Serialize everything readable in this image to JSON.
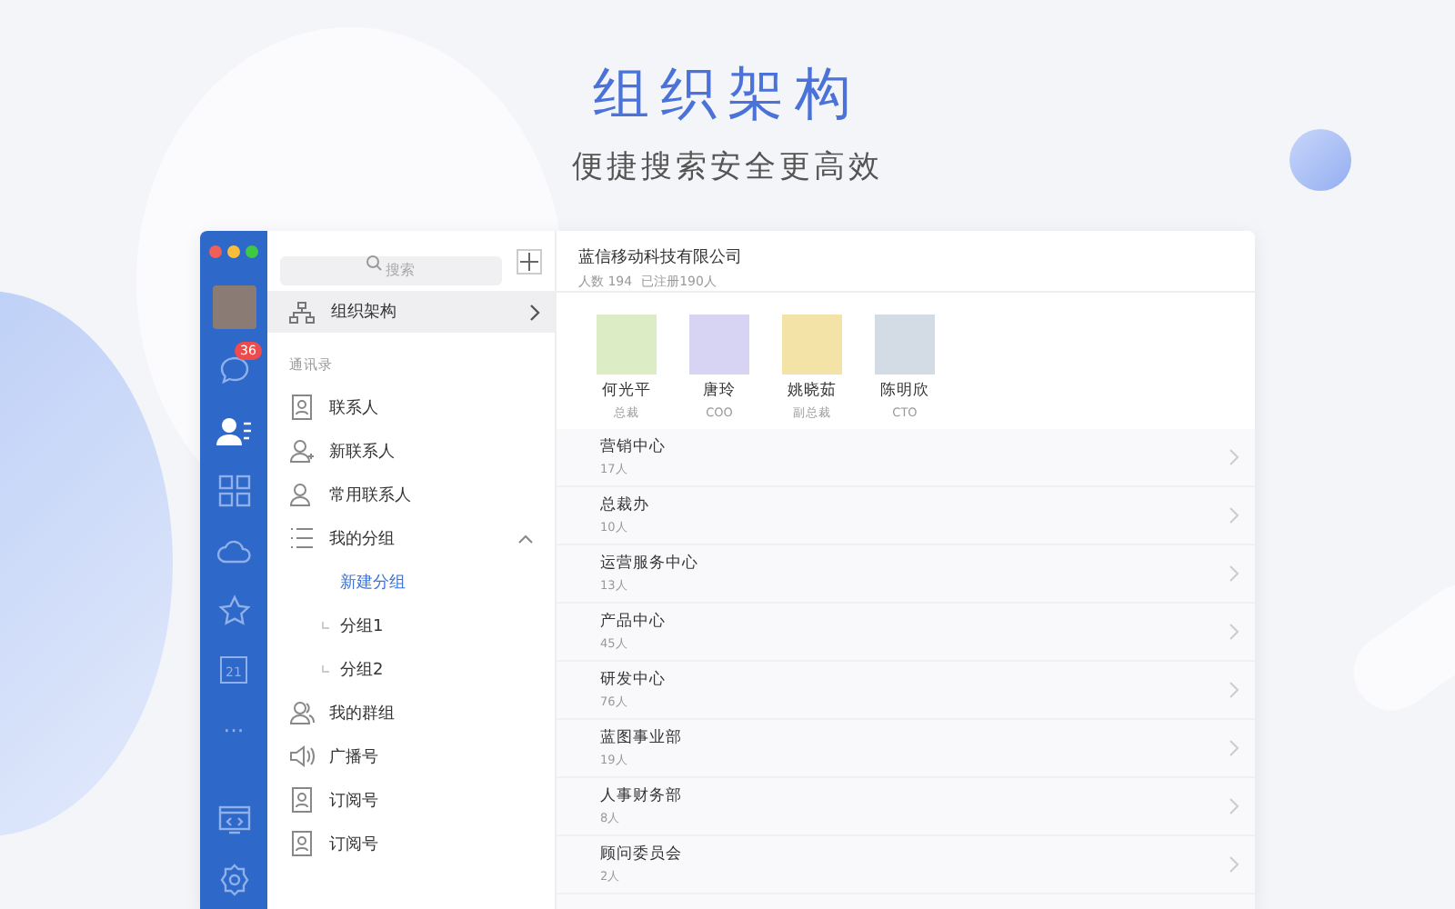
{
  "hero": {
    "title": "组织架构",
    "subtitle": "便捷搜索安全更高效"
  },
  "rail": {
    "items": [
      {
        "kind": "chat",
        "selected": false,
        "badge": "36"
      },
      {
        "kind": "contacts",
        "selected": true
      },
      {
        "kind": "apps",
        "selected": false
      },
      {
        "kind": "cloud",
        "selected": false
      },
      {
        "kind": "star",
        "selected": false
      },
      {
        "kind": "calendar",
        "selected": false,
        "text": "21"
      },
      {
        "kind": "more",
        "selected": false,
        "text": "···"
      }
    ],
    "bottom": [
      {
        "kind": "code",
        "selected": false
      },
      {
        "kind": "settings",
        "selected": false
      }
    ]
  },
  "sidebar": {
    "search": {
      "placeholder": "搜索"
    },
    "org": {
      "label": "组织架构",
      "selected": true
    },
    "section": "通讯录",
    "items": [
      {
        "kind": "contact",
        "label": "联系人"
      },
      {
        "kind": "new-contact",
        "label": "新联系人"
      },
      {
        "kind": "frequent",
        "label": "常用联系人"
      },
      {
        "kind": "groups",
        "label": "我的分组",
        "expanded": true,
        "children": [
          {
            "kind": "action",
            "label": "新建分组"
          },
          {
            "kind": "group",
            "label": "分组1"
          },
          {
            "kind": "group",
            "label": "分组2"
          }
        ]
      },
      {
        "kind": "team",
        "label": "我的群组"
      },
      {
        "kind": "broadcast",
        "label": "广播号"
      },
      {
        "kind": "subscription",
        "label": "订阅号"
      },
      {
        "kind": "subscription",
        "label": "订阅号"
      }
    ]
  },
  "company": {
    "name": "蓝信移动科技有限公司",
    "headcount": "人数 194",
    "registered": "已注册190人"
  },
  "executives": [
    {
      "name": "何光平",
      "title": "总裁",
      "color": "#dcecc4"
    },
    {
      "name": "唐玲",
      "title": "COO",
      "color": "#d6d3f3"
    },
    {
      "name": "姚晓茹",
      "title": "副总裁",
      "color": "#f3e3a6"
    },
    {
      "name": "陈明欣",
      "title": "CTO",
      "color": "#d3dbe4"
    }
  ],
  "departments": [
    {
      "name": "营销中心",
      "count": "17人"
    },
    {
      "name": "总裁办",
      "count": "10人"
    },
    {
      "name": "运营服务中心",
      "count": "13人"
    },
    {
      "name": "产品中心",
      "count": "45人"
    },
    {
      "name": "研发中心",
      "count": "76人"
    },
    {
      "name": "蓝图事业部",
      "count": "19人"
    },
    {
      "name": "人事财务部",
      "count": "8人"
    },
    {
      "name": "顾问委员会",
      "count": "2人"
    }
  ]
}
